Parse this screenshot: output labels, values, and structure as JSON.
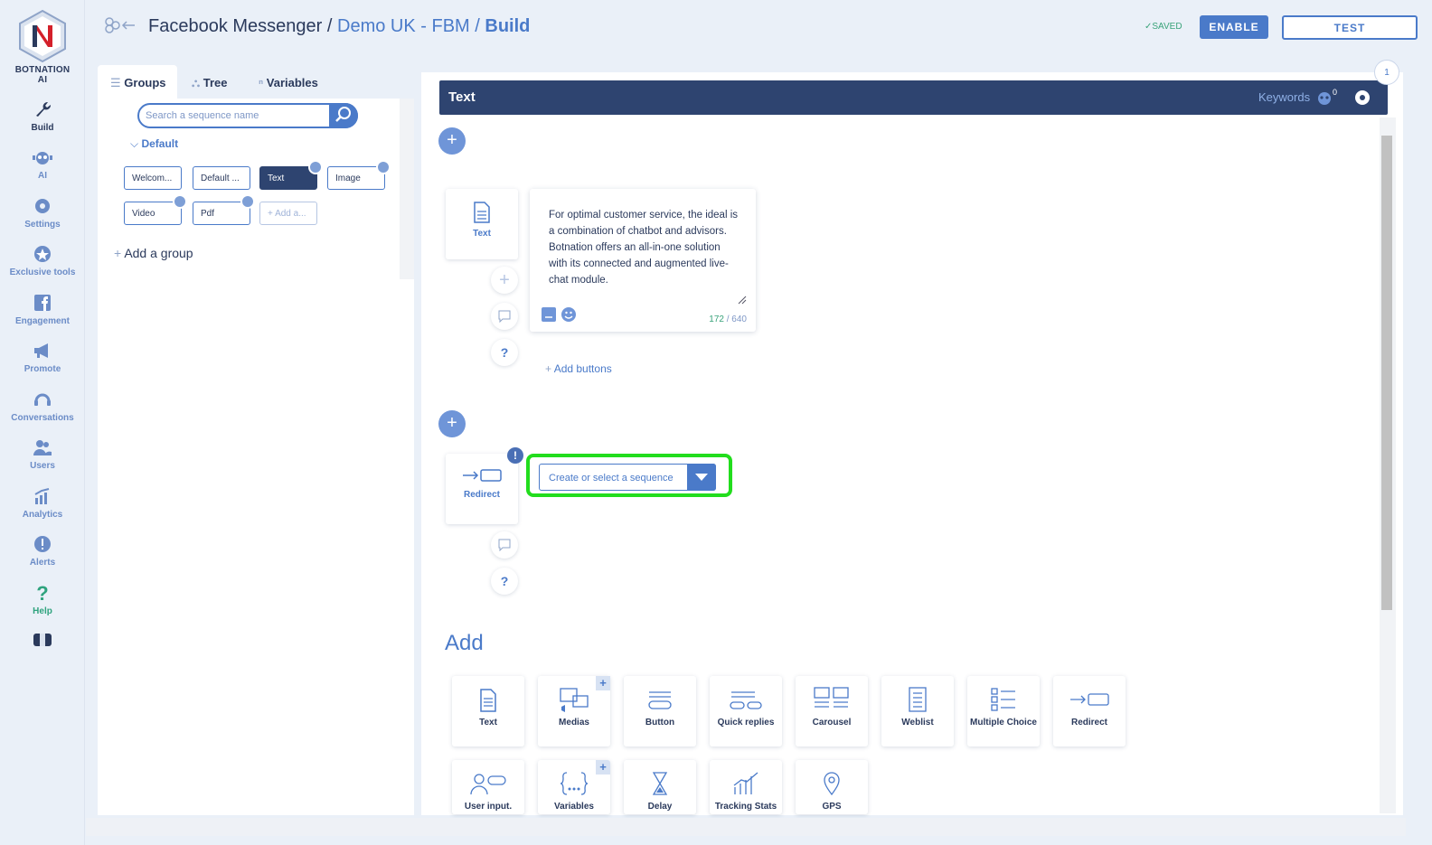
{
  "app": {
    "brand": "BOTNATION AI",
    "colors": {
      "primary": "#4a7ac9",
      "dark": "#2e4470",
      "success": "#3aa37a",
      "highlight": "#22dd1d"
    }
  },
  "nav": [
    {
      "label": "Build",
      "icon": "wrench-icon",
      "active": true
    },
    {
      "label": "AI",
      "icon": "robot-icon"
    },
    {
      "label": "Settings",
      "icon": "gear-icon"
    },
    {
      "label": "Exclusive tools",
      "icon": "star-icon"
    },
    {
      "label": "Engagement",
      "icon": "facebook-icon"
    },
    {
      "label": "Promote",
      "icon": "megaphone-icon"
    },
    {
      "label": "Conversations",
      "icon": "headset-icon"
    },
    {
      "label": "Users",
      "icon": "users-icon"
    },
    {
      "label": "Analytics",
      "icon": "chart-icon"
    },
    {
      "label": "Alerts",
      "icon": "alert-icon"
    },
    {
      "label": "Help",
      "icon": "question-icon"
    }
  ],
  "header": {
    "crumb1": "Facebook Messenger",
    "sep": "/",
    "crumb2": "Demo UK - FBM",
    "crumb3": "Build",
    "saved": "SAVED",
    "enable": "ENABLE",
    "test": "TEST"
  },
  "sidebar": {
    "tabs": [
      "Groups",
      "Tree",
      "Variables"
    ],
    "search_placeholder": "Search a sequence name",
    "group_name": "Default",
    "chips": [
      "Welcom...",
      "Default ...",
      "Text",
      "Image",
      "Video",
      "Pdf",
      "Add a..."
    ],
    "add_group": "Add a group"
  },
  "main": {
    "title": "Text",
    "keywords": "Keywords",
    "keywords_count": "0",
    "step": "1",
    "text_block_label": "Text",
    "message": "For optimal customer service, the ideal is a combination of chatbot and advisors. Botnation offers an all-in-one solution with its connected and augmented live-chat module.",
    "char_count": "172",
    "char_max": "/ 640",
    "add_buttons": "Add buttons",
    "redirect_label": "Redirect",
    "select_placeholder": "Create or select a sequence",
    "help_q": "?",
    "warn": "!",
    "add_title": "Add",
    "tiles": [
      "Text",
      "Medias",
      "Button",
      "Quick replies",
      "Carousel",
      "Weblist",
      "Multiple Choice",
      "Redirect",
      "User input.",
      "Variables",
      "Delay",
      "Tracking Stats",
      "GPS"
    ]
  }
}
